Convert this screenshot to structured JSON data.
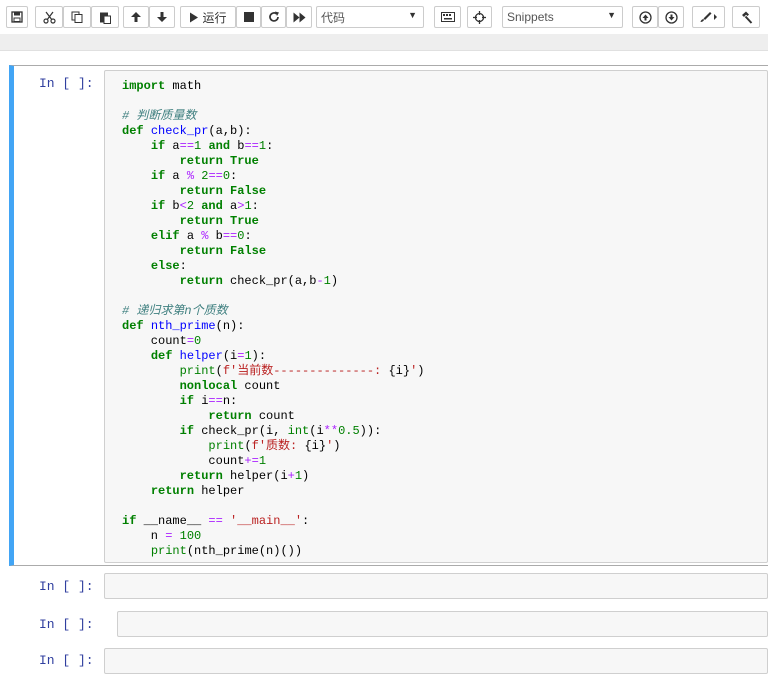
{
  "toolbar": {
    "run_label": "运行",
    "cell_type": "代码",
    "snippets": "Snippets",
    "buttons": [
      "save-icon",
      "cut-icon",
      "copy-icon",
      "paste-icon",
      "move-up-icon",
      "move-down-icon",
      "run-icon",
      "stop-icon",
      "restart-icon",
      "fast-forward-icon",
      "keyboard-icon",
      "crosshair-icon",
      "circle-up-icon",
      "circle-down-icon",
      "paintbrush-icon",
      "hammer-icon"
    ]
  },
  "cells": [
    {
      "prompt": "In [ ]:"
    },
    {
      "prompt": "In [ ]:"
    },
    {
      "prompt": "In [ ]:"
    },
    {
      "prompt": "In [ ]:"
    }
  ],
  "code": {
    "l01": "import math",
    "l02": "# 判断质量数",
    "l03": "def check_pr(a,b):",
    "l04": "    if a==1 and b==1:",
    "l05": "        return True",
    "l06": "    if a % 2==0:",
    "l07": "        return False",
    "l08": "    if b<2 and a>1:",
    "l09": "        return True",
    "l10": "    elif a % b==0:",
    "l11": "        return False",
    "l12": "    else:",
    "l13": "        return check_pr(a,b-1)",
    "l14": "# 递归求第n个质数",
    "l15": "def nth_prime(n):",
    "l16": "    count=0",
    "l17": "    def helper(i=1):",
    "l18": "        print(f'当前数--------------: {i}')",
    "l19": "        nonlocal count",
    "l20": "        if i==n:",
    "l21": "            return count",
    "l22": "        if check_pr(i, int(i**0.5)):",
    "l23": "            print(f'质数: {i}')",
    "l24": "            count+=1",
    "l25": "        return helper(i+1)",
    "l26": "    return helper",
    "l27": "if __name__ == '__main__':",
    "l28": "    n = 100",
    "l29": "    print(nth_prime(n)())"
  },
  "colors": {
    "accent": "#42a5f5",
    "prompt": "#303f9f",
    "keyword": "#008000",
    "operator": "#aa22ff",
    "comment": "#408080",
    "function": "#0000ff",
    "string": "#ba2121"
  }
}
